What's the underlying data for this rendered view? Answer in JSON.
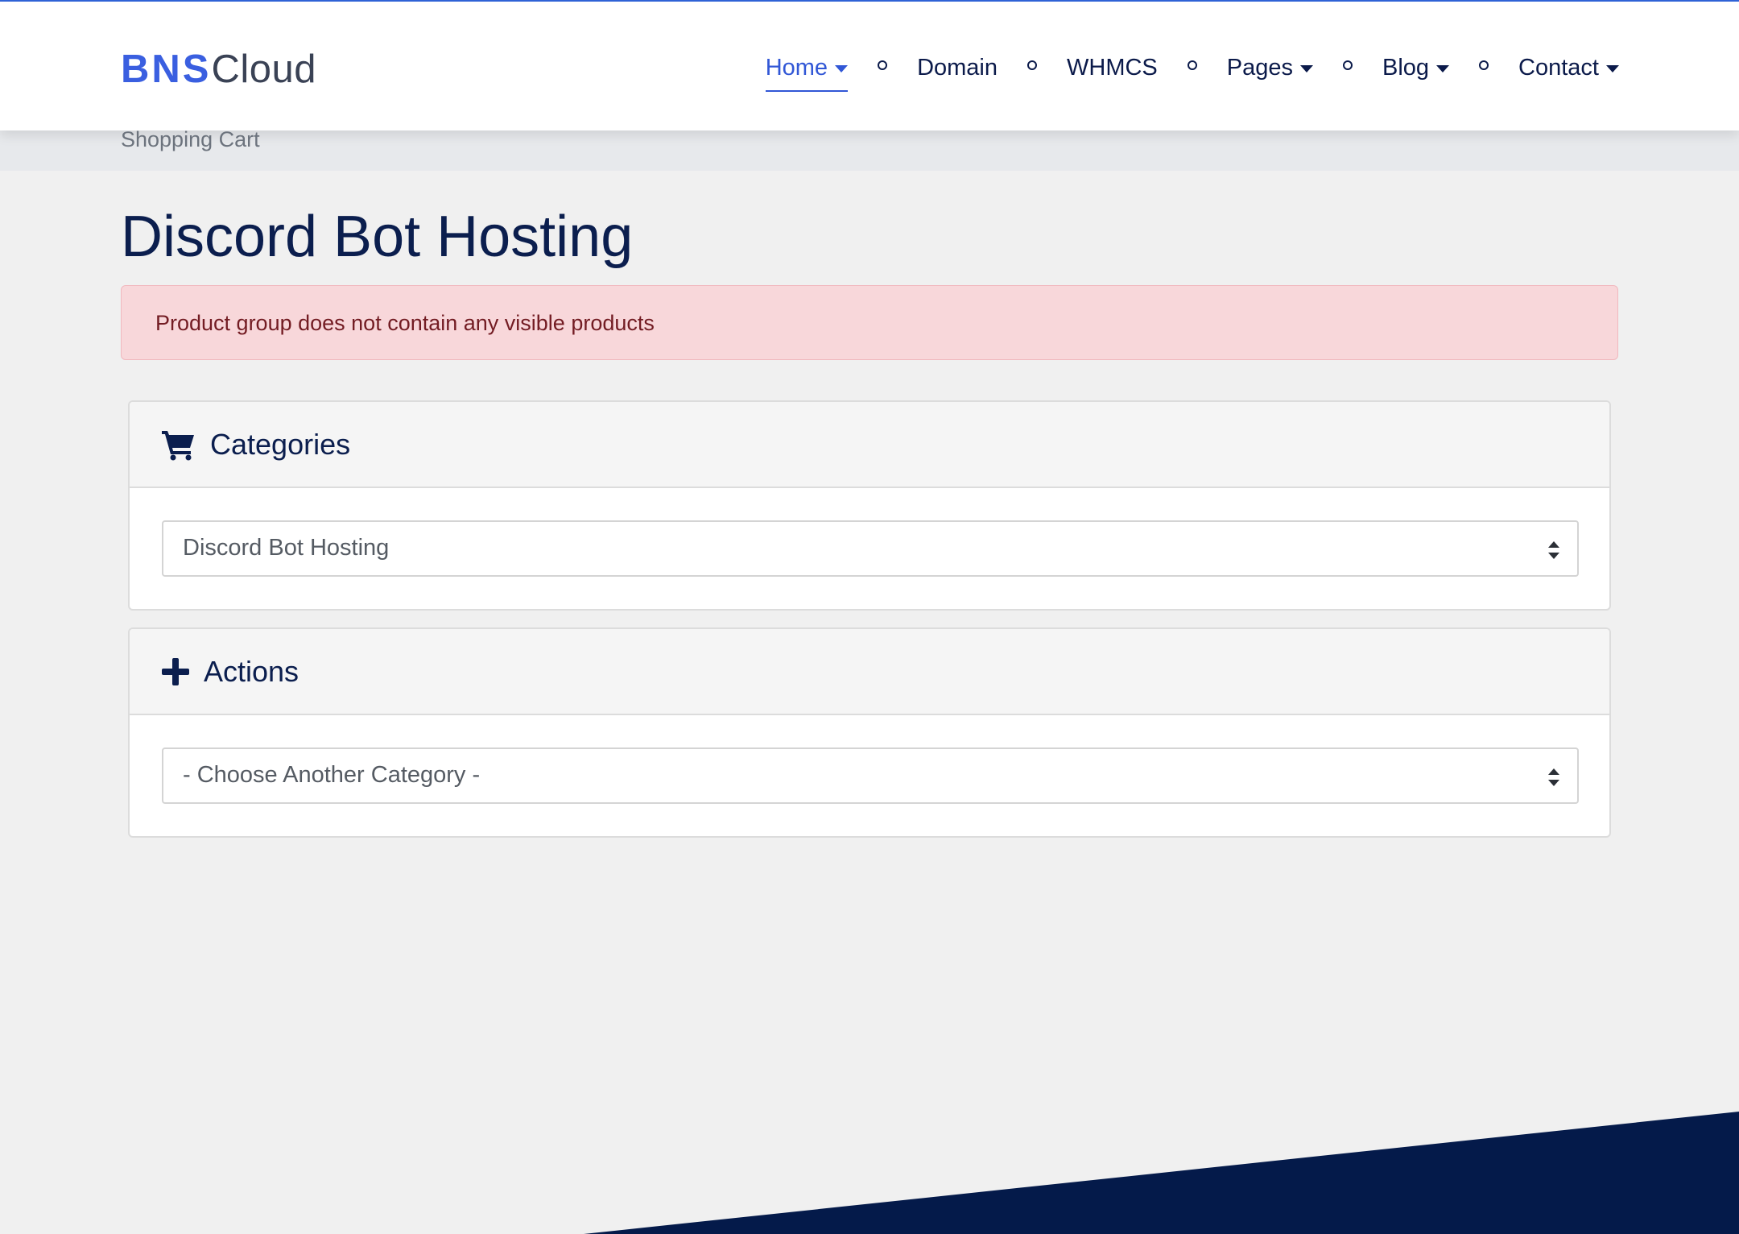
{
  "brand": {
    "part1": "BNS",
    "part2": "Cloud"
  },
  "nav": {
    "home": "Home",
    "domain": "Domain",
    "whmcs": "WHMCS",
    "pages": "Pages",
    "blog": "Blog",
    "contact": "Contact"
  },
  "breadcrumb": "Shopping Cart",
  "page": {
    "title": "Discord Bot Hosting"
  },
  "alert": "Product group does not contain any visible products",
  "categories": {
    "title": "Categories",
    "selected": "Discord Bot Hosting"
  },
  "actions": {
    "title": "Actions",
    "selected": "- Choose Another Category -"
  },
  "colors": {
    "accent": "#3157d6",
    "navy": "#0b1e4e",
    "alert_bg": "#f8d7da",
    "alert_text": "#731c23",
    "footer": "#041a4a"
  },
  "icons": {
    "categories": "shopping-cart-icon",
    "actions": "plus-icon"
  }
}
